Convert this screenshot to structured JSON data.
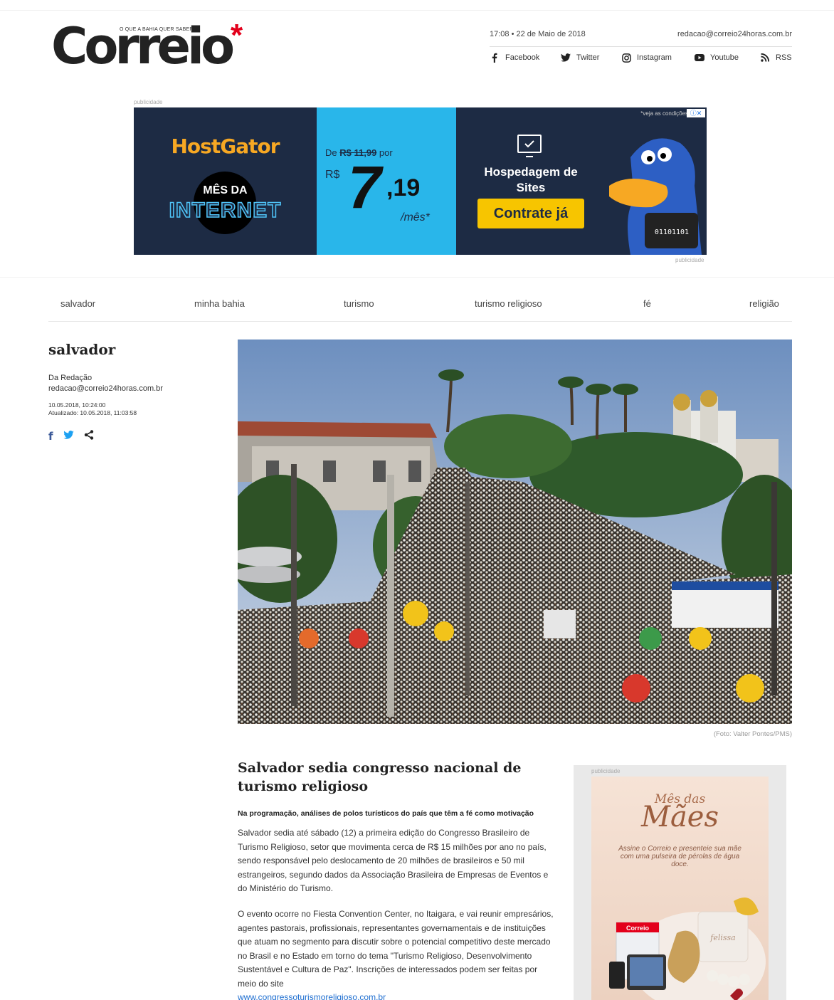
{
  "header": {
    "logo_tagline": "O QUE A BAHIA QUER SABER",
    "logo_text": "Correio",
    "logo_star": "*",
    "datetime": "17:08 • 22 de Maio de 2018",
    "email": "redacao@correio24horas.com.br",
    "social": [
      "Facebook",
      "Twitter",
      "Instagram",
      "Youtube",
      "RSS"
    ]
  },
  "banner_ad": {
    "label_top": "publicidade",
    "label_bottom": "publicidade",
    "brand": "HostGator",
    "promo_line1": "MÊS DA",
    "promo_line2": "INTERNET",
    "price_from_prefix": "De",
    "price_from": "R$ 11,99",
    "price_from_suffix": "por",
    "price_currency": "R$",
    "price_int": "7",
    "price_dec": ",19",
    "price_period": "/mês*",
    "conditions": "*veja as condições",
    "product": "Hospedagem de Sites",
    "cta": "Contrate já",
    "mascot_shirt": "01101101"
  },
  "nav": [
    "salvador",
    "minha bahia",
    "turismo",
    "turismo religioso",
    "fé",
    "religião"
  ],
  "sidebar": {
    "section": "salvador",
    "author": "Da Redação",
    "author_email": "redacao@correio24horas.com.br",
    "published": "10.05.2018, 10:24:00",
    "updated": "Atualizado: 10.05.2018, 11:03:58"
  },
  "photo": {
    "caption": "(Foto: Valter Pontes/PMS)"
  },
  "article": {
    "title": "Salvador sedia congresso nacional de turismo religioso",
    "subtitle": "Na programação, análises de polos turísticos do país que têm a fé como motivação",
    "p1": "Salvador sedia até sábado (12) a primeira edição do Congresso Brasileiro de Turismo Religioso, setor que movimenta cerca de R$ 15 milhões por ano no país, sendo responsável pelo deslocamento de 20 milhões de brasileiros e 50 mil estrangeiros, segundo dados da Associação Brasileira de Empresas de Eventos e do Ministério do Turismo.",
    "p2": "O evento ocorre no Fiesta Convention Center, no Itaigara, e vai reunir empresários, agentes pastorais, profissionais, representantes governamentais e de instituições que atuam no segmento para discutir sobre o potencial competitivo deste mercado no Brasil e no Estado em torno do tema \"Turismo Religioso, Desenvolvimento Sustentável e Cultura de Paz\". Inscrições de interessados podem ser feitas por meio do site",
    "link": "www.congressoturismoreligioso.com.br"
  },
  "side_ad": {
    "label": "publicidade",
    "title_small": "Mês das",
    "title_big": "Mães",
    "text": "Assine o Correio e presenteie sua mãe com uma pulseira de pérolas de água doce.",
    "box_brand": "felissa",
    "mag_brand": "Correio"
  }
}
